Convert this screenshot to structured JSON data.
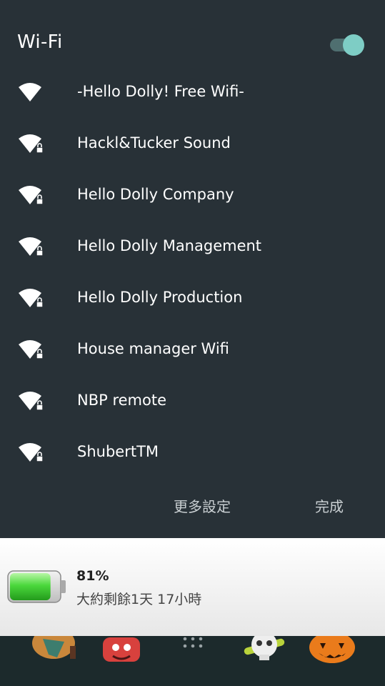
{
  "wifi": {
    "title": "Wi-Fi",
    "toggle_on": true,
    "networks": [
      {
        "name": "-Hello Dolly! Free Wifi-",
        "locked": false
      },
      {
        "name": "Hackl&Tucker Sound",
        "locked": true
      },
      {
        "name": "Hello Dolly Company",
        "locked": true
      },
      {
        "name": "Hello Dolly Management",
        "locked": true
      },
      {
        "name": "Hello Dolly Production",
        "locked": true
      },
      {
        "name": "House manager Wifi",
        "locked": true
      },
      {
        "name": "NBP remote",
        "locked": true
      },
      {
        "name": "ShubertTM",
        "locked": true
      }
    ],
    "more_settings_label": "更多設定",
    "done_label": "完成"
  },
  "battery": {
    "percent": "81%",
    "remaining": "大約剩餘1天 17小時",
    "level": 0.81
  },
  "colors": {
    "panel_bg": "#283137",
    "accent": "#7ecdc5",
    "battery_green": "#3fd43a"
  },
  "dock": {
    "icons": [
      "witch-app-icon",
      "red-creature-app-icon",
      "app-drawer-icon",
      "skull-app-icon",
      "pumpkin-app-icon"
    ]
  }
}
